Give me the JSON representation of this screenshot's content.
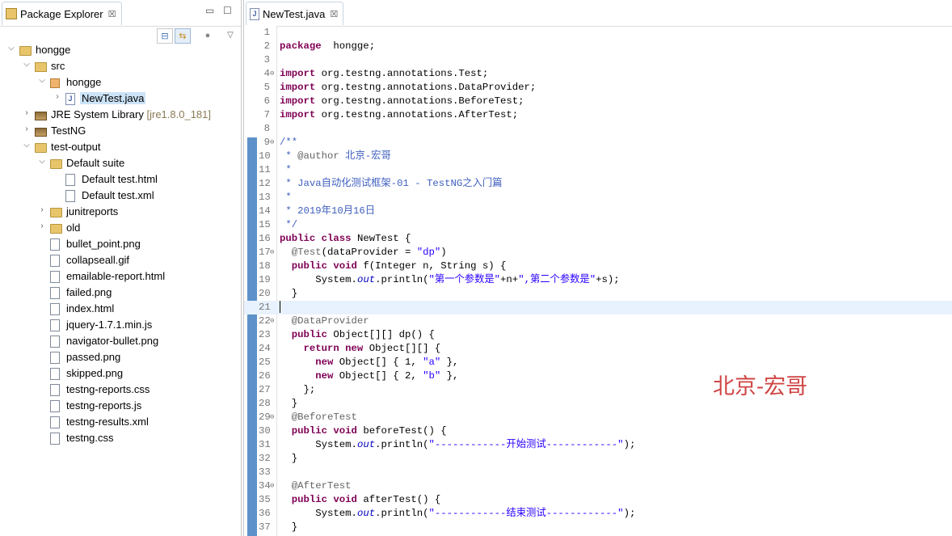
{
  "explorer": {
    "title": "Package Explorer",
    "close": "☒",
    "tree": [
      {
        "label": "hongge",
        "suffix": "",
        "indent": 0,
        "twisty": "v",
        "icon": "project-folder-icon"
      },
      {
        "label": "src",
        "suffix": "",
        "indent": 1,
        "twisty": "v",
        "icon": "source-folder-icon"
      },
      {
        "label": "hongge",
        "suffix": "",
        "indent": 2,
        "twisty": "v",
        "icon": "package-icon"
      },
      {
        "label": "NewTest.java",
        "suffix": "",
        "indent": 3,
        "twisty": ">",
        "icon": "java-file-icon",
        "selected": true
      },
      {
        "label": "JRE System Library",
        "suffix": " [jre1.8.0_181]",
        "indent": 1,
        "twisty": ">",
        "icon": "library-icon"
      },
      {
        "label": "TestNG",
        "suffix": "",
        "indent": 1,
        "twisty": ">",
        "icon": "library-icon"
      },
      {
        "label": "test-output",
        "suffix": "",
        "indent": 1,
        "twisty": "v",
        "icon": "folder-icon"
      },
      {
        "label": "Default suite",
        "suffix": "",
        "indent": 2,
        "twisty": "v",
        "icon": "folder-icon"
      },
      {
        "label": "Default test.html",
        "suffix": "",
        "indent": 3,
        "twisty": "",
        "icon": "file-icon"
      },
      {
        "label": "Default test.xml",
        "suffix": "",
        "indent": 3,
        "twisty": "",
        "icon": "file-icon"
      },
      {
        "label": "junitreports",
        "suffix": "",
        "indent": 2,
        "twisty": ">",
        "icon": "folder-icon"
      },
      {
        "label": "old",
        "suffix": "",
        "indent": 2,
        "twisty": ">",
        "icon": "folder-icon"
      },
      {
        "label": "bullet_point.png",
        "suffix": "",
        "indent": 2,
        "twisty": "",
        "icon": "file-icon"
      },
      {
        "label": "collapseall.gif",
        "suffix": "",
        "indent": 2,
        "twisty": "",
        "icon": "file-icon"
      },
      {
        "label": "emailable-report.html",
        "suffix": "",
        "indent": 2,
        "twisty": "",
        "icon": "file-icon"
      },
      {
        "label": "failed.png",
        "suffix": "",
        "indent": 2,
        "twisty": "",
        "icon": "file-icon"
      },
      {
        "label": "index.html",
        "suffix": "",
        "indent": 2,
        "twisty": "",
        "icon": "file-icon"
      },
      {
        "label": "jquery-1.7.1.min.js",
        "suffix": "",
        "indent": 2,
        "twisty": "",
        "icon": "file-icon"
      },
      {
        "label": "navigator-bullet.png",
        "suffix": "",
        "indent": 2,
        "twisty": "",
        "icon": "file-icon"
      },
      {
        "label": "passed.png",
        "suffix": "",
        "indent": 2,
        "twisty": "",
        "icon": "file-icon"
      },
      {
        "label": "skipped.png",
        "suffix": "",
        "indent": 2,
        "twisty": "",
        "icon": "file-icon"
      },
      {
        "label": "testng-reports.css",
        "suffix": "",
        "indent": 2,
        "twisty": "",
        "icon": "file-icon"
      },
      {
        "label": "testng-reports.js",
        "suffix": "",
        "indent": 2,
        "twisty": "",
        "icon": "file-icon"
      },
      {
        "label": "testng-results.xml",
        "suffix": "",
        "indent": 2,
        "twisty": "",
        "icon": "file-icon"
      },
      {
        "label": "testng.css",
        "suffix": "",
        "indent": 2,
        "twisty": "",
        "icon": "file-icon"
      }
    ]
  },
  "editor": {
    "tab_label": "NewTest.java",
    "close": "☒",
    "lines": [
      {
        "n": "1",
        "fold": "",
        "segs": []
      },
      {
        "n": "2",
        "fold": "",
        "segs": [
          [
            "kw",
            "package"
          ],
          [
            "",
            "  hongge;"
          ]
        ]
      },
      {
        "n": "3",
        "fold": "",
        "segs": []
      },
      {
        "n": "4",
        "fold": "⊖",
        "segs": [
          [
            "kw",
            "import"
          ],
          [
            "",
            " org.testng.annotations.Test;"
          ]
        ]
      },
      {
        "n": "5",
        "fold": "",
        "segs": [
          [
            "kw",
            "import"
          ],
          [
            "",
            " org.testng.annotations.DataProvider;"
          ]
        ]
      },
      {
        "n": "6",
        "fold": "",
        "segs": [
          [
            "kw",
            "import"
          ],
          [
            "",
            " org.testng.annotations.BeforeTest;"
          ]
        ]
      },
      {
        "n": "7",
        "fold": "",
        "segs": [
          [
            "kw",
            "import"
          ],
          [
            "",
            " org.testng.annotations.AfterTest;"
          ]
        ]
      },
      {
        "n": "8",
        "fold": "",
        "segs": []
      },
      {
        "n": "9",
        "fold": "⊖",
        "segs": [
          [
            "cm",
            "/**"
          ]
        ]
      },
      {
        "n": "10",
        "fold": "",
        "segs": [
          [
            "cm",
            " * "
          ],
          [
            "an",
            "@author"
          ],
          [
            "cm",
            " 北京-宏哥"
          ]
        ]
      },
      {
        "n": "11",
        "fold": "",
        "segs": [
          [
            "cm",
            " *"
          ]
        ]
      },
      {
        "n": "12",
        "fold": "",
        "segs": [
          [
            "cm",
            " * Java自动化测试框架-01 - TestNG之入门篇"
          ]
        ]
      },
      {
        "n": "13",
        "fold": "",
        "segs": [
          [
            "cm",
            " *"
          ]
        ]
      },
      {
        "n": "14",
        "fold": "",
        "segs": [
          [
            "cm",
            " * 2019年10月16日"
          ]
        ]
      },
      {
        "n": "15",
        "fold": "",
        "segs": [
          [
            "cm",
            " */"
          ]
        ]
      },
      {
        "n": "16",
        "fold": "",
        "segs": [
          [
            "kw",
            "public class"
          ],
          [
            "",
            " NewTest {"
          ]
        ]
      },
      {
        "n": "17",
        "fold": "⊖",
        "segs": [
          [
            "an",
            "  @Test"
          ],
          [
            "",
            "(dataProvider = "
          ],
          [
            "st",
            "\"dp\""
          ],
          [
            "",
            ")"
          ]
        ]
      },
      {
        "n": "18",
        "fold": "",
        "segs": [
          [
            "kw",
            "  public void"
          ],
          [
            "",
            " f(Integer n, String s) {"
          ]
        ]
      },
      {
        "n": "19",
        "fold": "",
        "segs": [
          [
            "",
            "      System."
          ],
          [
            "fld",
            "out"
          ],
          [
            "",
            ".println("
          ],
          [
            "st",
            "\"第一个参数是\""
          ],
          [
            "",
            "+n+"
          ],
          [
            "st",
            "\",第二个参数是\""
          ],
          [
            "",
            "+s);"
          ]
        ]
      },
      {
        "n": "20",
        "fold": "",
        "segs": [
          [
            "",
            "  }"
          ]
        ]
      },
      {
        "n": "21",
        "fold": "",
        "segs": [],
        "current": true
      },
      {
        "n": "22",
        "fold": "⊖",
        "segs": [
          [
            "an",
            "  @DataProvider"
          ]
        ]
      },
      {
        "n": "23",
        "fold": "",
        "segs": [
          [
            "kw",
            "  public"
          ],
          [
            "",
            " Object[][] dp() {"
          ]
        ]
      },
      {
        "n": "24",
        "fold": "",
        "segs": [
          [
            "kw",
            "    return new"
          ],
          [
            "",
            " Object[][] {"
          ]
        ]
      },
      {
        "n": "25",
        "fold": "",
        "segs": [
          [
            "kw",
            "      new"
          ],
          [
            "",
            " Object[] { 1, "
          ],
          [
            "st",
            "\"a\""
          ],
          [
            "",
            " },"
          ]
        ]
      },
      {
        "n": "26",
        "fold": "",
        "segs": [
          [
            "kw",
            "      new"
          ],
          [
            "",
            " Object[] { 2, "
          ],
          [
            "st",
            "\"b\""
          ],
          [
            "",
            " },"
          ]
        ]
      },
      {
        "n": "27",
        "fold": "",
        "segs": [
          [
            "",
            "    };"
          ]
        ]
      },
      {
        "n": "28",
        "fold": "",
        "segs": [
          [
            "",
            "  }"
          ]
        ]
      },
      {
        "n": "29",
        "fold": "⊖",
        "segs": [
          [
            "an",
            "  @BeforeTest"
          ]
        ]
      },
      {
        "n": "30",
        "fold": "",
        "segs": [
          [
            "kw",
            "  public void"
          ],
          [
            "",
            " beforeTest() {"
          ]
        ]
      },
      {
        "n": "31",
        "fold": "",
        "segs": [
          [
            "",
            "      System."
          ],
          [
            "fld",
            "out"
          ],
          [
            "",
            ".println("
          ],
          [
            "st",
            "\"------------开始测试------------\""
          ],
          [
            "",
            ");"
          ]
        ]
      },
      {
        "n": "32",
        "fold": "",
        "segs": [
          [
            "",
            "  }"
          ]
        ]
      },
      {
        "n": "33",
        "fold": "",
        "segs": []
      },
      {
        "n": "34",
        "fold": "⊖",
        "segs": [
          [
            "an",
            "  @AfterTest"
          ]
        ]
      },
      {
        "n": "35",
        "fold": "",
        "segs": [
          [
            "kw",
            "  public void"
          ],
          [
            "",
            " afterTest() {"
          ]
        ]
      },
      {
        "n": "36",
        "fold": "",
        "segs": [
          [
            "",
            "      System."
          ],
          [
            "fld",
            "out"
          ],
          [
            "",
            ".println("
          ],
          [
            "st",
            "\"------------结束测试------------\""
          ],
          [
            "",
            ");"
          ]
        ]
      },
      {
        "n": "37",
        "fold": "",
        "segs": [
          [
            "",
            "  }"
          ]
        ]
      }
    ],
    "watermark": "北京-宏哥"
  }
}
